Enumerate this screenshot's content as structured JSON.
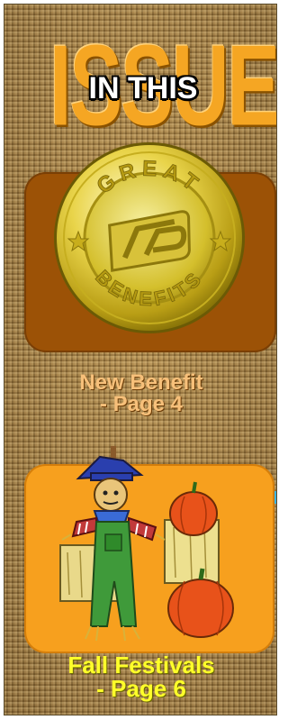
{
  "heading": {
    "big_word": "ISSUE",
    "small_words": "IN THIS"
  },
  "items": [
    {
      "icon": "great-benefits-coin",
      "coin_top_text": "GREAT",
      "coin_bottom_text": "BENEFITS",
      "title": "New Benefit",
      "page": "- Page 4",
      "card_color": "#9c5206",
      "caption_color": "#f7c07a"
    },
    {
      "icon": "scarecrow-with-pumpkins",
      "title": "Fall Festivals",
      "page": "- Page 6",
      "card_color": "#f7a01e",
      "caption_color": "#ffff2a"
    }
  ],
  "colors": {
    "burlap": "#a57f45",
    "issue_orange": "#f5a623"
  }
}
